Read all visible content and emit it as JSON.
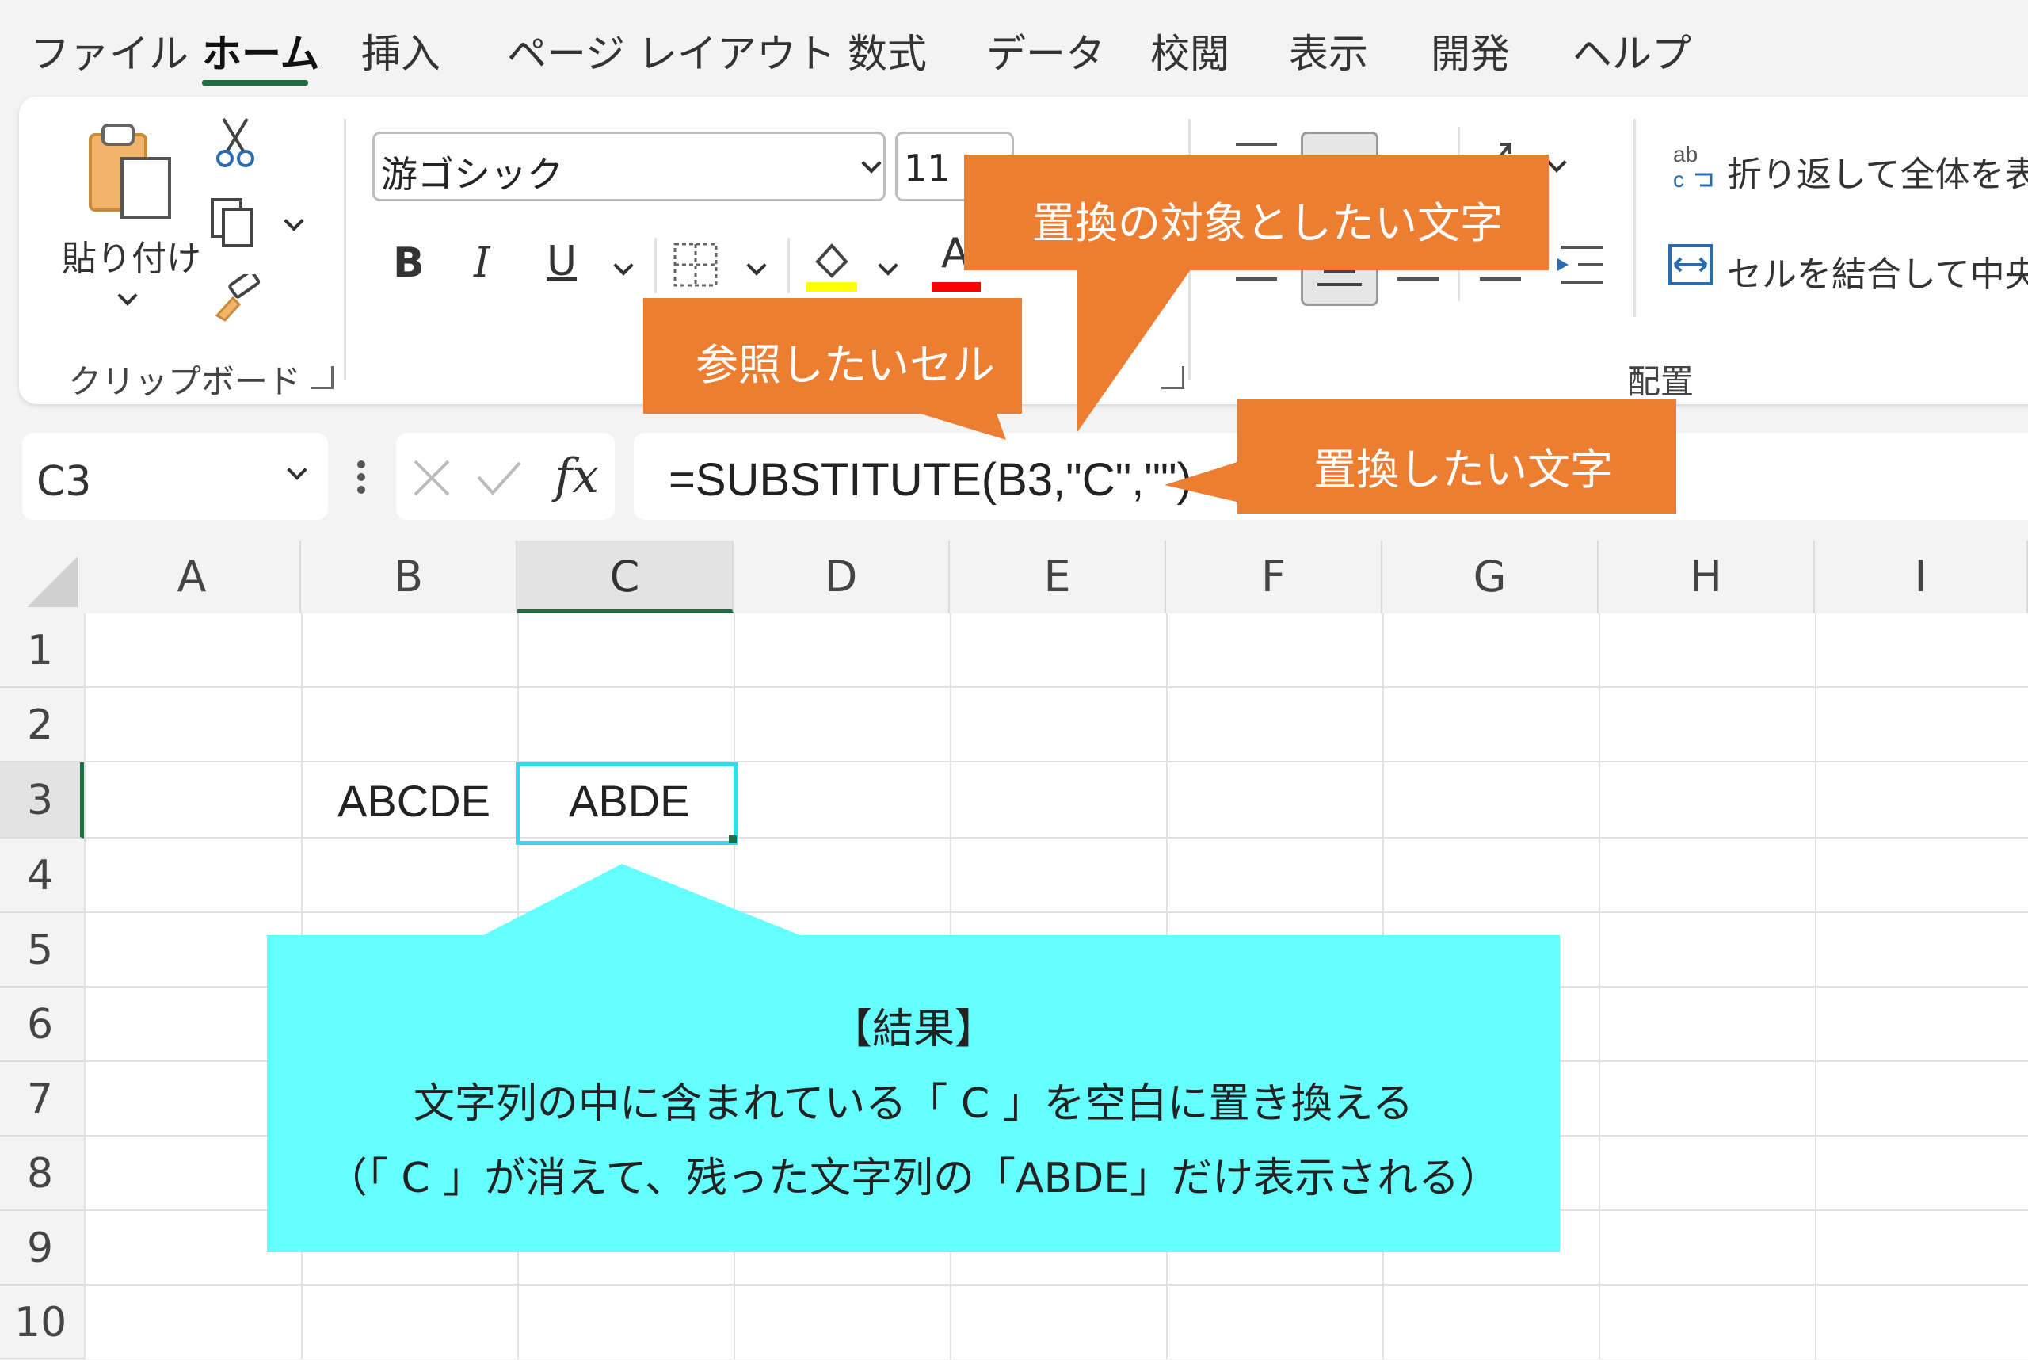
{
  "tabs": [
    "ファイル",
    "ホーム",
    "挿入",
    "ページ レイアウト",
    "数式",
    "データ",
    "校閲",
    "表示",
    "開発",
    "ヘルプ"
  ],
  "active_tab": "ホーム",
  "ribbon": {
    "paste_label": "貼り付け",
    "clipboard_group": "クリップボード",
    "font_name": "游ゴシック",
    "font_size": "11",
    "bold": "B",
    "italic": "I",
    "underline": "U",
    "font_color_glyph": "A",
    "wrap_text": "折り返して全体を表示",
    "merge_center": "セルを結合して中央揃え",
    "alignment_group": "配置",
    "fill_color": "#ffff00",
    "font_color": "#ff0000"
  },
  "formula_bar": {
    "name_box": "C3",
    "fx": "fx",
    "formula": "=SUBSTITUTE(B3,\"C\",\"\")"
  },
  "grid": {
    "columns": [
      "A",
      "B",
      "C",
      "D",
      "E",
      "F",
      "G",
      "H",
      "I"
    ],
    "rows": [
      "1",
      "2",
      "3",
      "4",
      "5",
      "6",
      "7",
      "8",
      "9",
      "10"
    ],
    "selected_cell": "C3",
    "cells": {
      "B3": "ABCDE",
      "C3": "ABDE"
    }
  },
  "callouts": {
    "target_text": "置換の対象としたい文字",
    "ref_cell": "参照したいセル",
    "replace_text": "置換したい文字",
    "result_title": "【結果】",
    "result_line1": "文字列の中に含まれている「 C 」を空白に置き換える",
    "result_line2": "（「 C 」が消えて、残った文字列の「ABDE」だけ表示される）",
    "orange_color": "#ed7d31",
    "cyan_color": "#66ffff"
  }
}
